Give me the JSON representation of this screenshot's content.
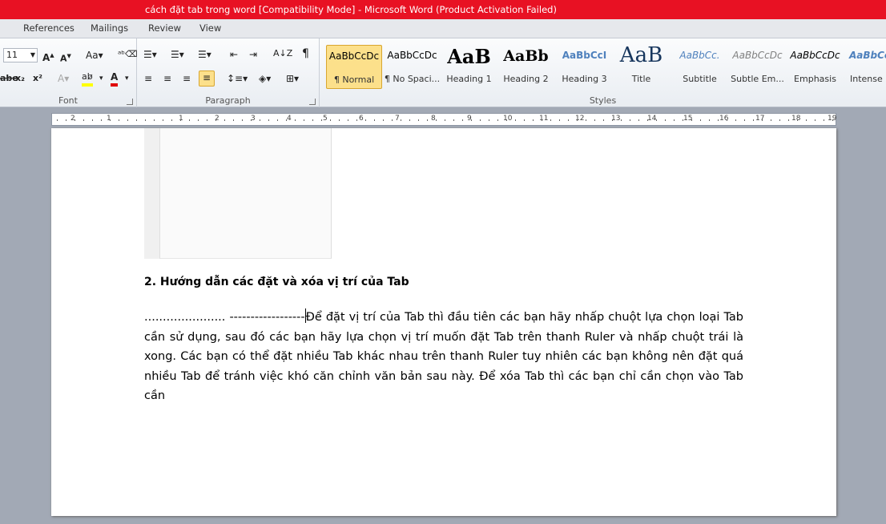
{
  "titlebar": {
    "title": "cách đặt tab trong word [Compatibility Mode]  -  Microsoft Word (Product Activation Failed)"
  },
  "tabs": [
    "References",
    "Mailings",
    "Review",
    "View"
  ],
  "ribbon": {
    "font": {
      "size": "11",
      "label": "Font"
    },
    "paragraph": {
      "label": "Paragraph"
    },
    "styles": {
      "label": "Styles",
      "items": [
        {
          "preview": "AaBbCcDc",
          "label": "¶ Normal"
        },
        {
          "preview": "AaBbCcDc",
          "label": "¶ No Spaci..."
        },
        {
          "preview": "AaB",
          "label": "Heading 1"
        },
        {
          "preview": "AaBb",
          "label": "Heading 2"
        },
        {
          "preview": "AaBbCcI",
          "label": "Heading 3"
        },
        {
          "preview": "AaB",
          "label": "Title"
        },
        {
          "preview": "AaBbCc.",
          "label": "Subtitle"
        },
        {
          "preview": "AaBbCcDc",
          "label": "Subtle Em..."
        },
        {
          "preview": "AaBbCcDc",
          "label": "Emphasis"
        },
        {
          "preview": "AaBbCc",
          "label": "Intense E"
        }
      ]
    }
  },
  "ruler": {
    "left_numbers": [
      "2",
      "1"
    ],
    "right_numbers": [
      "1",
      "2",
      "3",
      "4",
      "5",
      "6",
      "7",
      "8",
      "9",
      "10",
      "11",
      "12",
      "13",
      "14",
      "15",
      "16",
      "17",
      "18",
      "19"
    ]
  },
  "document": {
    "heading": "2. Hướng dẫn các đặt và xóa vị trí của Tab",
    "leader_dots": "......................",
    "leader_dashes": "------------------",
    "line1_rest": "Để đặt vị trí của Tab thì đầu tiên các bạn hãy nhấp chuột lựa chọn loại",
    "body": "Tab cần sử dụng, sau đó các bạn hãy lựa chọn vị trí muốn đặt Tab trên thanh Ruler và nhấp chuột trái là xong. Các bạn có thể đặt nhiều Tab khác nhau trên thanh Ruler tuy nhiên các bạn không nên đặt quá nhiều Tab để tránh việc khó căn chỉnh văn bản sau này. Để xóa Tab thì các bạn chỉ cần chọn vào Tab cần"
  }
}
